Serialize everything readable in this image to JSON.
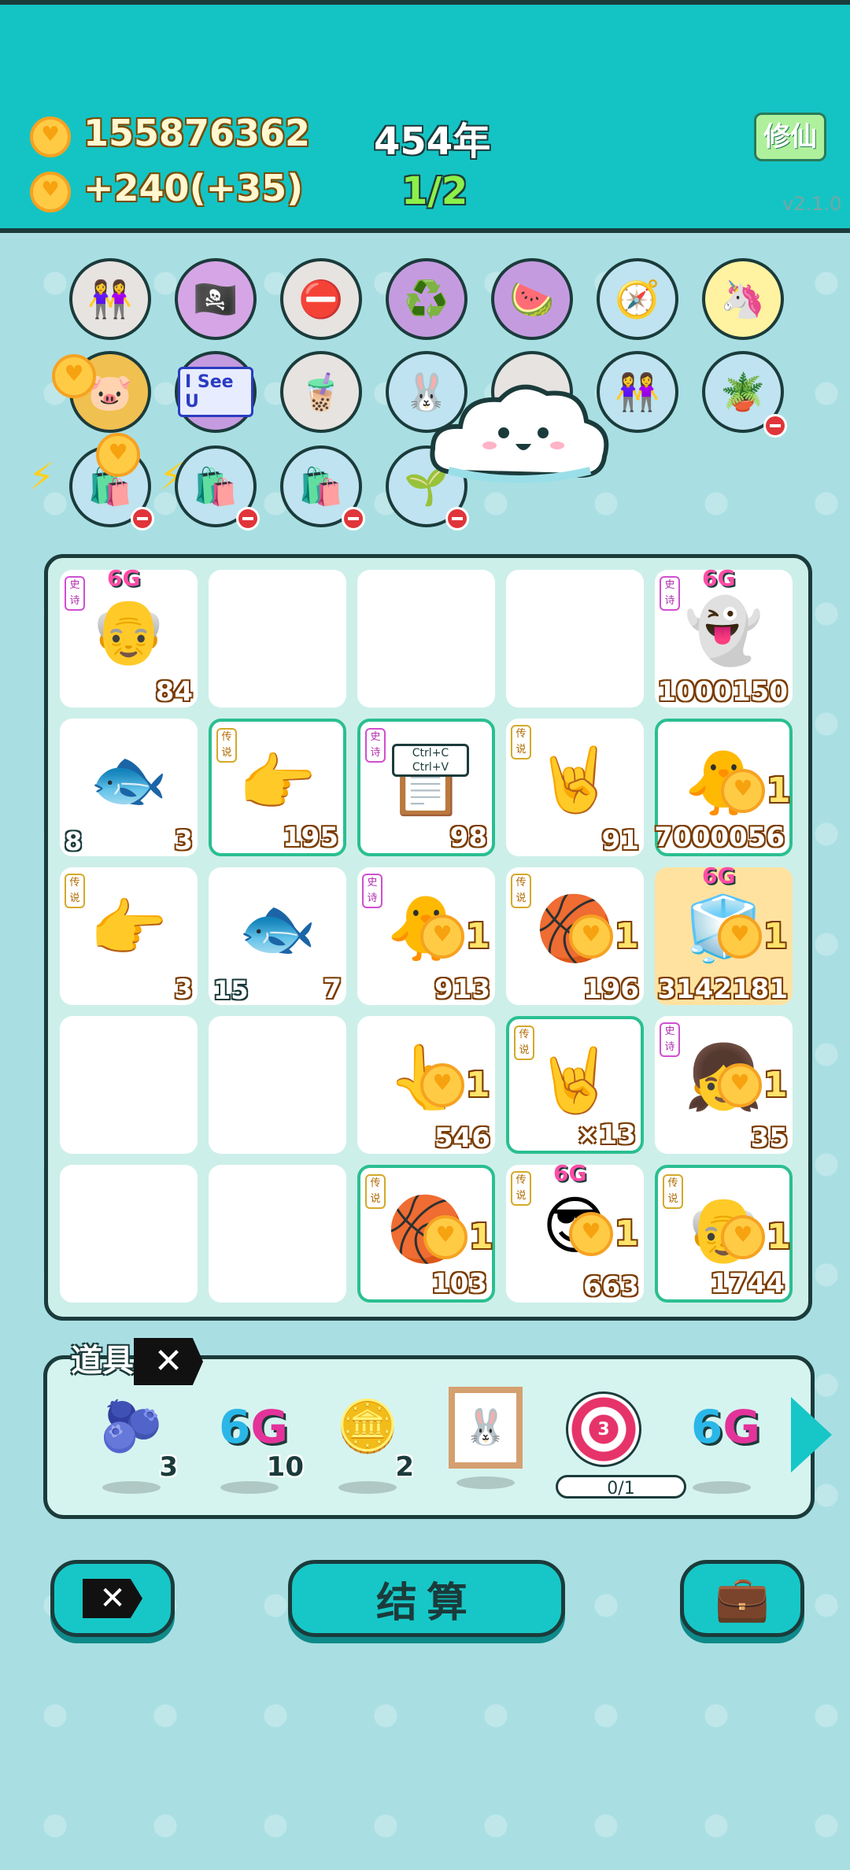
{
  "header": {
    "coins": "155876362",
    "income": "+240(+35)",
    "year": "454年",
    "ratio": "1/2",
    "xiuxian_button": "修仙",
    "version": "v2.1.0"
  },
  "board": {
    "cells": [
      {
        "row": 0,
        "col": 0,
        "icon": "old-man-crowned",
        "tag": "史诗",
        "badge": "6G",
        "value": "84"
      },
      {
        "row": 0,
        "col": 1,
        "icon": "empty"
      },
      {
        "row": 0,
        "col": 2,
        "icon": "empty"
      },
      {
        "row": 0,
        "col": 3,
        "icon": "empty"
      },
      {
        "row": 0,
        "col": 4,
        "icon": "ghost-crowned",
        "tag": "史诗",
        "badge": "6G",
        "value": "1000150"
      },
      {
        "row": 1,
        "col": 0,
        "icon": "goldfish",
        "left_value": "8",
        "value": "3"
      },
      {
        "row": 1,
        "col": 1,
        "icon": "pointing-hand-crowned",
        "tag": "传说",
        "value": "195",
        "legendary": true
      },
      {
        "row": 1,
        "col": 2,
        "icon": "ctrl-c-ctrl-v",
        "tag": "史诗",
        "value": "98",
        "legendary": true,
        "text_a": "Ctrl+C",
        "text_b": "Ctrl+V"
      },
      {
        "row": 1,
        "col": 3,
        "icon": "rock-hand",
        "tag": "传说",
        "value": "91"
      },
      {
        "row": 1,
        "col": 4,
        "icon": "chick-grey-hair",
        "value": "7000056",
        "legendary": true,
        "mult": "1"
      },
      {
        "row": 2,
        "col": 0,
        "icon": "pointing-hand",
        "tag": "传说",
        "value": "3"
      },
      {
        "row": 2,
        "col": 1,
        "icon": "goldfish",
        "left_value": "15",
        "value": "7"
      },
      {
        "row": 2,
        "col": 2,
        "icon": "chick-grey-hair",
        "tag": "史诗",
        "value": "913",
        "mult": "1"
      },
      {
        "row": 2,
        "col": 3,
        "icon": "fist-basketball",
        "tag": "传说",
        "value": "196",
        "mult": "1"
      },
      {
        "row": 2,
        "col": 4,
        "icon": "fridge",
        "badge": "6G",
        "value": "3142181",
        "gold": true,
        "mult": "1"
      },
      {
        "row": 3,
        "col": 0,
        "icon": "empty"
      },
      {
        "row": 3,
        "col": 1,
        "icon": "empty"
      },
      {
        "row": 3,
        "col": 2,
        "icon": "grey-hand",
        "value": "546",
        "mult": "1"
      },
      {
        "row": 3,
        "col": 3,
        "icon": "rock-hand-crowned",
        "tag": "传说",
        "value": "×13",
        "legendary": true
      },
      {
        "row": 3,
        "col": 4,
        "icon": "girl-face",
        "tag": "史诗",
        "value": "35",
        "mult": "1"
      },
      {
        "row": 4,
        "col": 0,
        "icon": "empty"
      },
      {
        "row": 4,
        "col": 1,
        "icon": "empty"
      },
      {
        "row": 4,
        "col": 2,
        "icon": "fist-basketball",
        "tag": "传说",
        "value": "103",
        "legendary": true,
        "mult": "1"
      },
      {
        "row": 4,
        "col": 3,
        "icon": "sunglasses-man",
        "tag": "传说",
        "badge": "6G",
        "value": "663",
        "mult": "1"
      },
      {
        "row": 4,
        "col": 4,
        "icon": "old-man-glasses-crowned",
        "tag": "传说",
        "value": "1744",
        "legendary": true,
        "mult": "1"
      }
    ]
  },
  "symbols_row1": [
    "two-girls",
    "eye-patch-ball",
    "no-entry",
    "recycle",
    "fruit-basket",
    "compass",
    "unicorn"
  ],
  "symbols_row2": [
    "pig-shield",
    "i-see-u",
    "bubble-tea",
    "rabbit",
    "mystery",
    "two-girls",
    "flower-pot"
  ],
  "symbols_row3": [
    "rice-bag",
    "rice-bag",
    "rice-bag",
    "bonsai",
    "cloud-mascot"
  ],
  "i_see_u_text": "I See U",
  "items": {
    "title": "道具",
    "list": [
      {
        "icon": "blueberry",
        "count": "3"
      },
      {
        "icon": "6g",
        "count": "10",
        "text": "6G"
      },
      {
        "icon": "dollar-coin",
        "count": "2"
      },
      {
        "icon": "rabbit-frame",
        "count": ""
      },
      {
        "icon": "target-3",
        "count": "",
        "progress": "0/1",
        "inner": "3"
      },
      {
        "icon": "6g",
        "count": "",
        "text": "6G"
      }
    ]
  },
  "bottom": {
    "settle_label": "结算"
  },
  "colors": {
    "header": "#14c4c4",
    "background": "#a9dfe3",
    "outline": "#1b3b3b",
    "legendary_border": "#2abf90"
  }
}
